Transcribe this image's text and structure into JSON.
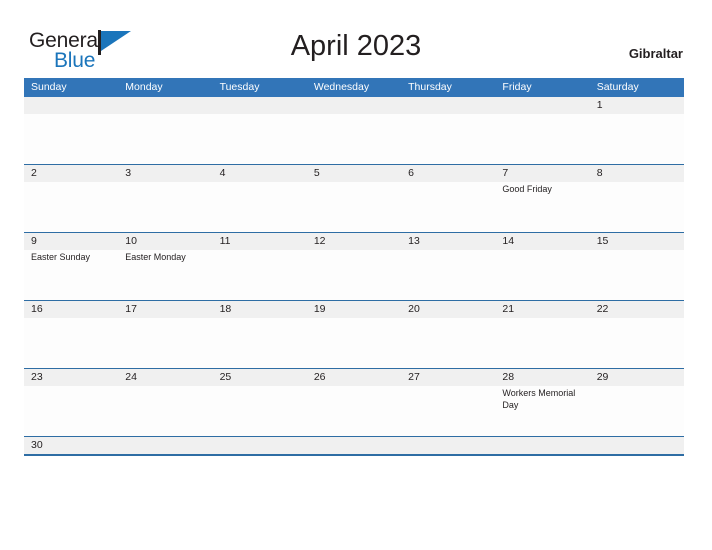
{
  "brand": {
    "word_one": "General",
    "word_two": "Blue",
    "flag_icon": "blue-flag-triangle-icon",
    "color_dark": "#231f20",
    "color_blue": "#1b75bb"
  },
  "header": {
    "title": "April 2023",
    "country": "Gibraltar"
  },
  "theme": {
    "header_blue": "#3275b8",
    "rule_blue": "#2e6da4",
    "number_band_gray": "#f0f0f0",
    "cell_white": "#fdfdfd"
  },
  "calendar": {
    "day_names": [
      "Sunday",
      "Monday",
      "Tuesday",
      "Wednesday",
      "Thursday",
      "Friday",
      "Saturday"
    ],
    "weeks": [
      {
        "short": false,
        "days": [
          {
            "num": "",
            "event": ""
          },
          {
            "num": "",
            "event": ""
          },
          {
            "num": "",
            "event": ""
          },
          {
            "num": "",
            "event": ""
          },
          {
            "num": "",
            "event": ""
          },
          {
            "num": "",
            "event": ""
          },
          {
            "num": "1",
            "event": ""
          }
        ]
      },
      {
        "short": false,
        "days": [
          {
            "num": "2",
            "event": ""
          },
          {
            "num": "3",
            "event": ""
          },
          {
            "num": "4",
            "event": ""
          },
          {
            "num": "5",
            "event": ""
          },
          {
            "num": "6",
            "event": ""
          },
          {
            "num": "7",
            "event": "Good Friday"
          },
          {
            "num": "8",
            "event": ""
          }
        ]
      },
      {
        "short": false,
        "days": [
          {
            "num": "9",
            "event": "Easter Sunday"
          },
          {
            "num": "10",
            "event": "Easter Monday"
          },
          {
            "num": "11",
            "event": ""
          },
          {
            "num": "12",
            "event": ""
          },
          {
            "num": "13",
            "event": ""
          },
          {
            "num": "14",
            "event": ""
          },
          {
            "num": "15",
            "event": ""
          }
        ]
      },
      {
        "short": false,
        "days": [
          {
            "num": "16",
            "event": ""
          },
          {
            "num": "17",
            "event": ""
          },
          {
            "num": "18",
            "event": ""
          },
          {
            "num": "19",
            "event": ""
          },
          {
            "num": "20",
            "event": ""
          },
          {
            "num": "21",
            "event": ""
          },
          {
            "num": "22",
            "event": ""
          }
        ]
      },
      {
        "short": false,
        "days": [
          {
            "num": "23",
            "event": ""
          },
          {
            "num": "24",
            "event": ""
          },
          {
            "num": "25",
            "event": ""
          },
          {
            "num": "26",
            "event": ""
          },
          {
            "num": "27",
            "event": ""
          },
          {
            "num": "28",
            "event": "Workers Memorial Day"
          },
          {
            "num": "29",
            "event": ""
          }
        ]
      },
      {
        "short": true,
        "days": [
          {
            "num": "30",
            "event": ""
          },
          {
            "num": "",
            "event": ""
          },
          {
            "num": "",
            "event": ""
          },
          {
            "num": "",
            "event": ""
          },
          {
            "num": "",
            "event": ""
          },
          {
            "num": "",
            "event": ""
          },
          {
            "num": "",
            "event": ""
          }
        ]
      }
    ]
  }
}
